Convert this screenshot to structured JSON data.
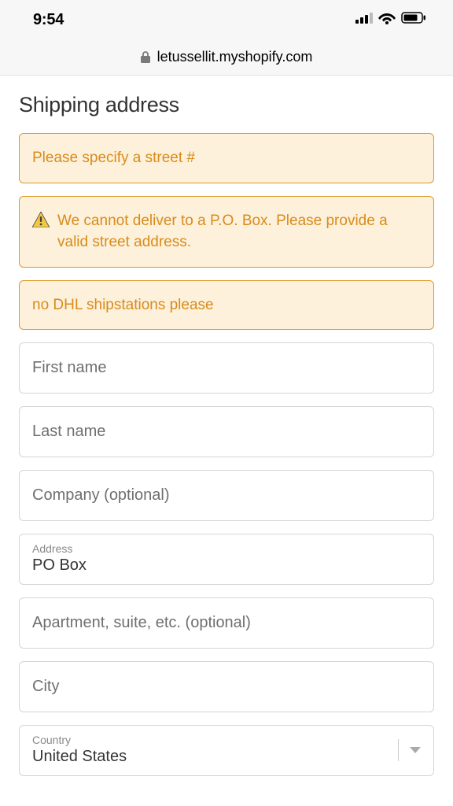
{
  "statusBar": {
    "time": "9:54"
  },
  "browser": {
    "url": "letussellit.myshopify.com"
  },
  "page": {
    "title": "Shipping address"
  },
  "alerts": [
    {
      "text": "Please specify a street #"
    },
    {
      "text": "We cannot deliver to a P.O. Box. Please provide a valid street address.",
      "icon": true
    },
    {
      "text": "no DHL shipstations please"
    }
  ],
  "fields": {
    "firstName": {
      "placeholder": "First name",
      "value": ""
    },
    "lastName": {
      "placeholder": "Last name",
      "value": ""
    },
    "company": {
      "placeholder": "Company (optional)",
      "value": ""
    },
    "address": {
      "label": "Address",
      "value": "PO Box"
    },
    "apartment": {
      "placeholder": "Apartment, suite, etc. (optional)",
      "value": ""
    },
    "city": {
      "placeholder": "City",
      "value": ""
    },
    "country": {
      "label": "Country",
      "value": "United States"
    }
  }
}
